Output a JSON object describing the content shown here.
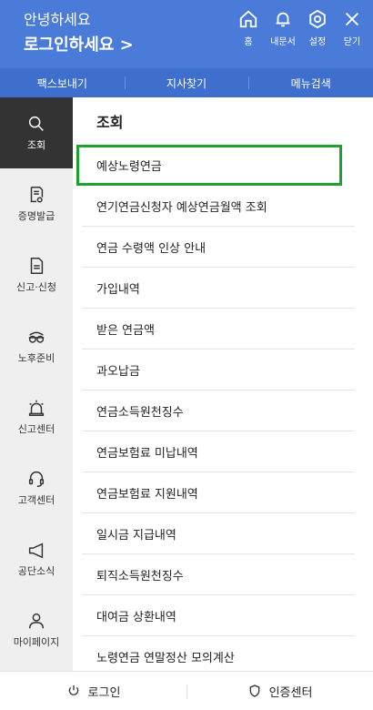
{
  "header": {
    "greeting": "안녕하세요",
    "login_link": "로그인하세요 >",
    "buttons": [
      {
        "icon": "home-icon",
        "label": "홈"
      },
      {
        "icon": "bell-icon",
        "label": "내문서"
      },
      {
        "icon": "gear-icon",
        "label": "설정"
      },
      {
        "icon": "close-icon",
        "label": "닫기"
      }
    ],
    "bg_color": "#4a7bd9"
  },
  "subnav": {
    "items": [
      "팩스보내기",
      "지사찾기",
      "메뉴검색"
    ],
    "bg_color": "#3f6fcc"
  },
  "sidebar": {
    "items": [
      {
        "icon": "search-icon",
        "label": "조회",
        "active": true
      },
      {
        "icon": "document-check-icon",
        "label": "증명발급"
      },
      {
        "icon": "document-icon",
        "label": "신고·신청"
      },
      {
        "icon": "glasses-icon",
        "label": "노후준비"
      },
      {
        "icon": "siren-icon",
        "label": "신고센터"
      },
      {
        "icon": "headset-icon",
        "label": "고객센터"
      },
      {
        "icon": "megaphone-icon",
        "label": "공단소식"
      },
      {
        "icon": "person-icon",
        "label": "마이페이지"
      }
    ]
  },
  "main": {
    "section_title": "조회",
    "items": [
      "예상노령연금",
      "연기연금신청자 예상연금월액 조회",
      "연금 수령액 인상 안내",
      "가입내역",
      "받은 연금액",
      "과오납금",
      "연금소득원천징수",
      "연금보험료 미납내역",
      "연금보험료 지원내역",
      "일시금 지급내역",
      "퇴직소득원천징수",
      "대여금 상환내역",
      "노령연금 연말정산 모의계산"
    ],
    "highlight_color": "#1fa12f"
  },
  "bottom": {
    "login_label": "로그인",
    "cert_label": "인증센터"
  }
}
